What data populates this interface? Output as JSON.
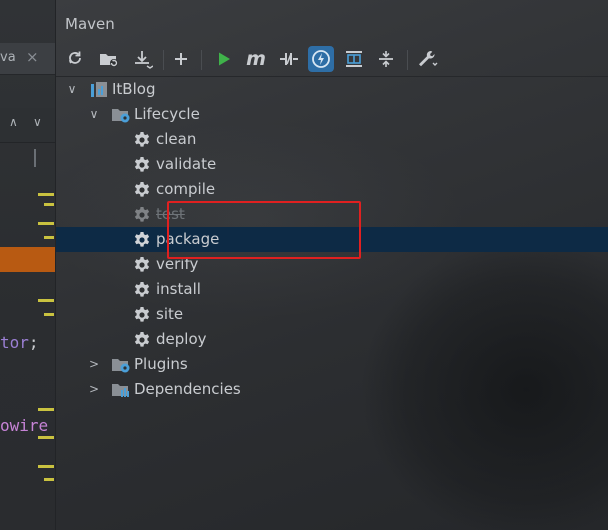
{
  "editor": {
    "tab_label": "va",
    "tab_close": "×",
    "nav_up": "∧",
    "nav_down": "∨",
    "code_line_1": "tor",
    "code_line_1_semi": ";",
    "code_line_2": "owire"
  },
  "panel": {
    "title": "Maven"
  },
  "toolbar": {
    "icons": [
      "reload-icon",
      "add-folder-icon",
      "download-icon",
      "plus-icon",
      "run-icon",
      "execute-goal-icon",
      "toggle-offline-icon",
      "skip-tests-icon",
      "show-dependencies-icon",
      "collapse-all-icon",
      "settings-wrench-icon"
    ],
    "accent_green": "#3fb24a",
    "accent_blue": "#2e6ea6"
  },
  "tree": {
    "project": {
      "label": "ItBlog",
      "arrow": "∨"
    },
    "lifecycle": {
      "label": "Lifecycle",
      "arrow": "∨"
    },
    "goals": [
      {
        "label": "clean"
      },
      {
        "label": "validate"
      },
      {
        "label": "compile"
      },
      {
        "label": "test",
        "disabled": true
      },
      {
        "label": "package",
        "selected": true
      },
      {
        "label": "verify"
      },
      {
        "label": "install"
      },
      {
        "label": "site"
      },
      {
        "label": "deploy"
      }
    ],
    "plugins": {
      "label": "Plugins",
      "arrow": ">"
    },
    "dependencies": {
      "label": "Dependencies",
      "arrow": ">"
    }
  },
  "highlight_color": "#e02020"
}
